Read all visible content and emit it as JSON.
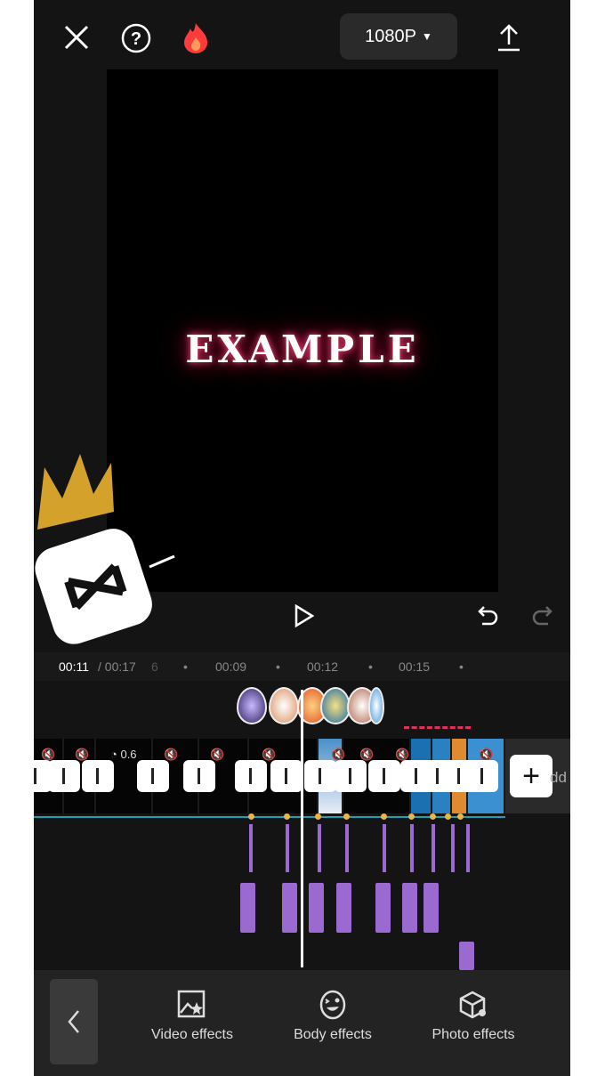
{
  "header": {
    "resolution": "1080P",
    "icons": [
      "close-icon",
      "help-icon",
      "fire-icon",
      "export-icon"
    ]
  },
  "preview": {
    "overlay_text": "EXAMPLE"
  },
  "controls": {
    "icons": [
      "play-icon",
      "undo-icon",
      "redo-icon"
    ]
  },
  "ruler": {
    "current": "00:11",
    "total": "/ 00:17",
    "partial": "6",
    "ticks": [
      "00:09",
      "00:12",
      "00:15"
    ]
  },
  "timeline": {
    "speed_label": "0.6",
    "add_label": "dd"
  },
  "toolbar": {
    "items": [
      {
        "label": "Video effects",
        "icon": "video-effects-icon"
      },
      {
        "label": "Body effects",
        "icon": "body-effects-icon"
      },
      {
        "label": "Photo effects",
        "icon": "photo-effects-icon"
      }
    ]
  },
  "colors": {
    "accent_purple": "#9b6ad0",
    "keyframe": "#e8b64a",
    "track_line": "#1fa0b0"
  }
}
